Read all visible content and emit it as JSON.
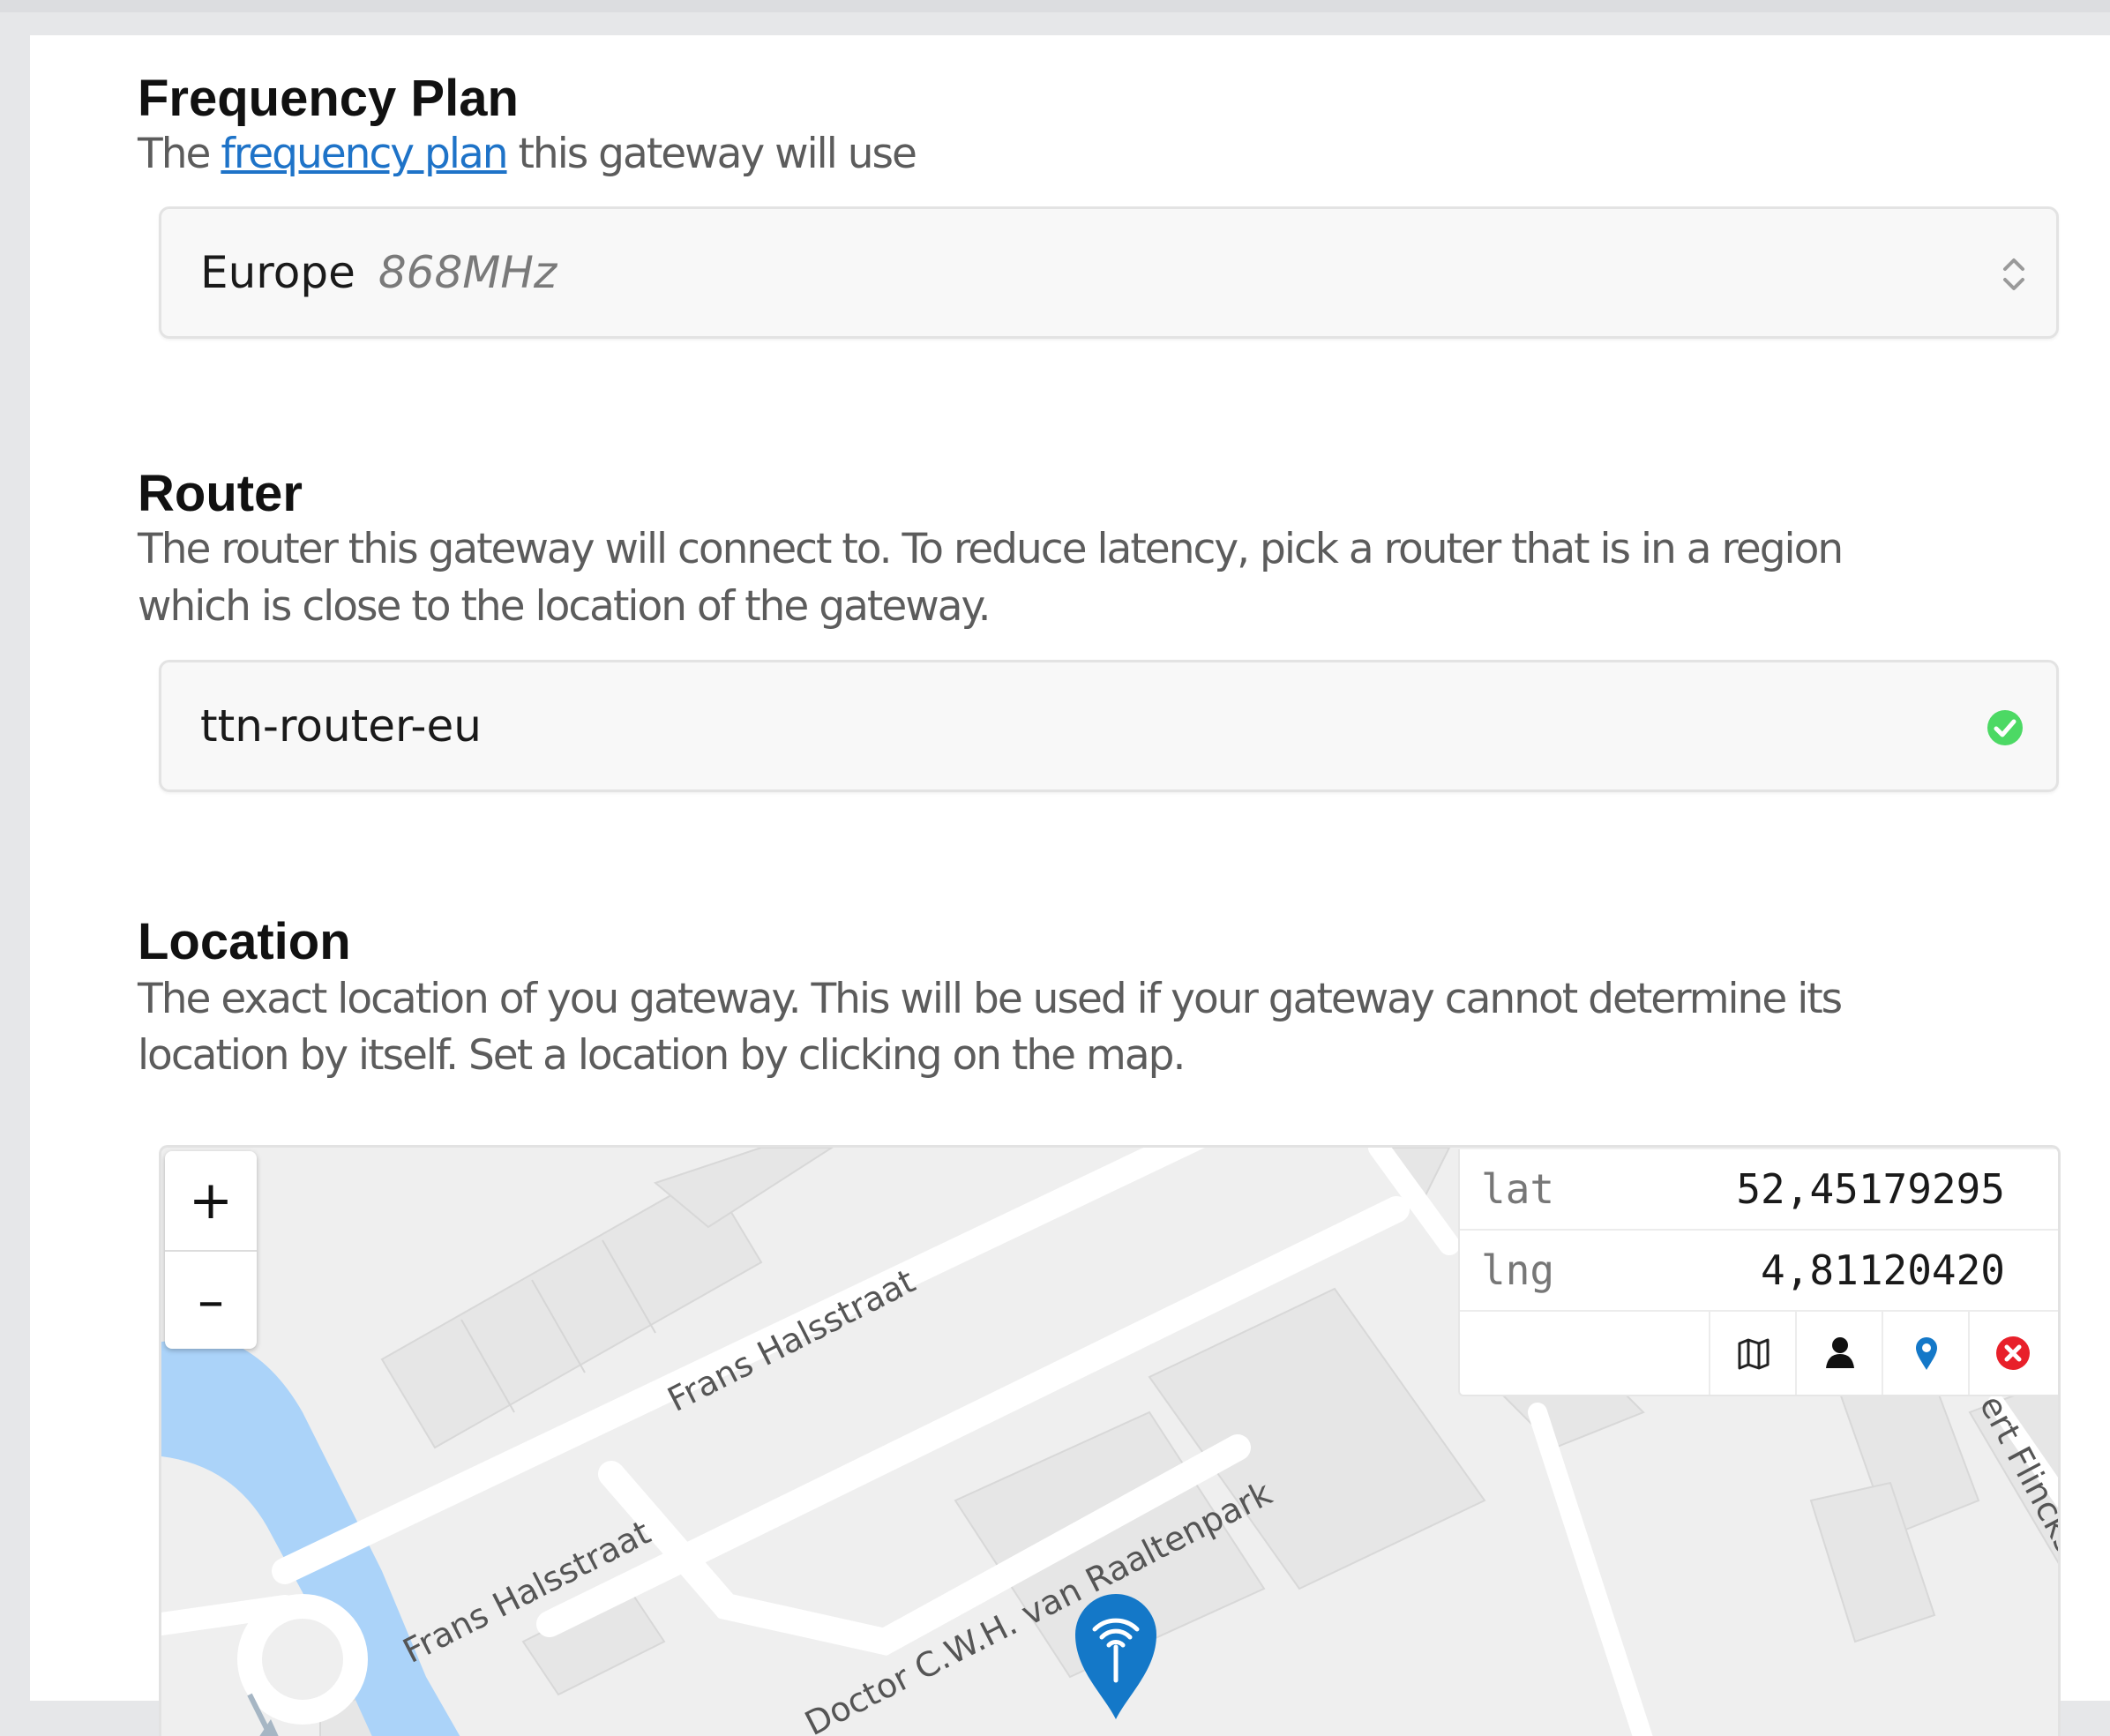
{
  "frequency_plan": {
    "title": "Frequency Plan",
    "desc_before": "The",
    "desc_link": "frequency plan",
    "desc_after": "this gateway will use",
    "select_value": "Europe",
    "select_sub": "868MHz"
  },
  "router": {
    "title": "Router",
    "desc_line1": "The router this gateway will connect to. To reduce latency, pick a router that is in a region",
    "desc_line2": "which is close to the location of the gateway.",
    "value": "ttn-router-eu"
  },
  "location": {
    "title": "Location",
    "desc_line1": "The exact location of you gateway. This will be used if your gateway cannot determine its",
    "desc_line2": "location by itself. Set a location by clicking on the map.",
    "map": {
      "zoom_in": "+",
      "zoom_out": "–",
      "lat_label": "lat",
      "lat_value": "52,45179295",
      "lng_label": "lng",
      "lng_value": "4,81120420",
      "streets": [
        "Frans Halsstraat",
        "Frans Halsstraat",
        "Doctor C.W.H. van Raaltenpark",
        "vert Flinckstraat"
      ],
      "tools": [
        "map-icon",
        "person-icon",
        "pin-icon",
        "close-icon"
      ],
      "colors": {
        "water": "#abd3f9",
        "marker": "#1478c8",
        "ok": "#4cd964",
        "error": "#e8202a"
      }
    }
  }
}
